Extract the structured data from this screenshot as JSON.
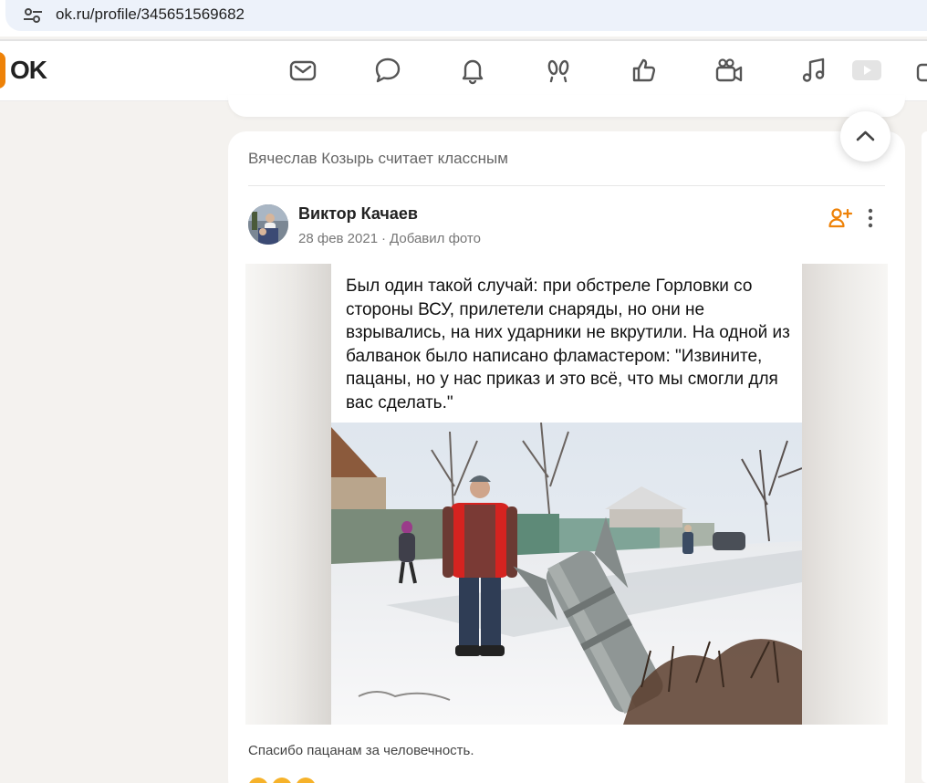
{
  "browser": {
    "url": "ok.ru/profile/345651569682"
  },
  "topnav": {
    "logo": "OK",
    "icons": [
      "mail-icon",
      "chat-icon",
      "bell-icon",
      "guests-icon",
      "like-icon",
      "video-camera-icon",
      "music-icon",
      "video-icon",
      "gift-icon"
    ]
  },
  "post": {
    "liked_by": "Вячеслав Козырь считает классным",
    "author": "Виктор Качаев",
    "date": "28 фев 2021",
    "action": "Добавил фото",
    "image_caption": "Был один такой случай: при обстреле Горловки со стороны ВСУ, прилетели снаряды, но они не взрывались, на них ударники не вкрутили.  На одной из балванок было написано фламастером: \"Извините, пацаны, но у нас приказ и это всё, что мы смогли для вас сделать.\"",
    "text": "Спасибо пацанам за человечность."
  },
  "colors": {
    "brand": "#ee8208",
    "background": "#f4f2ef"
  }
}
